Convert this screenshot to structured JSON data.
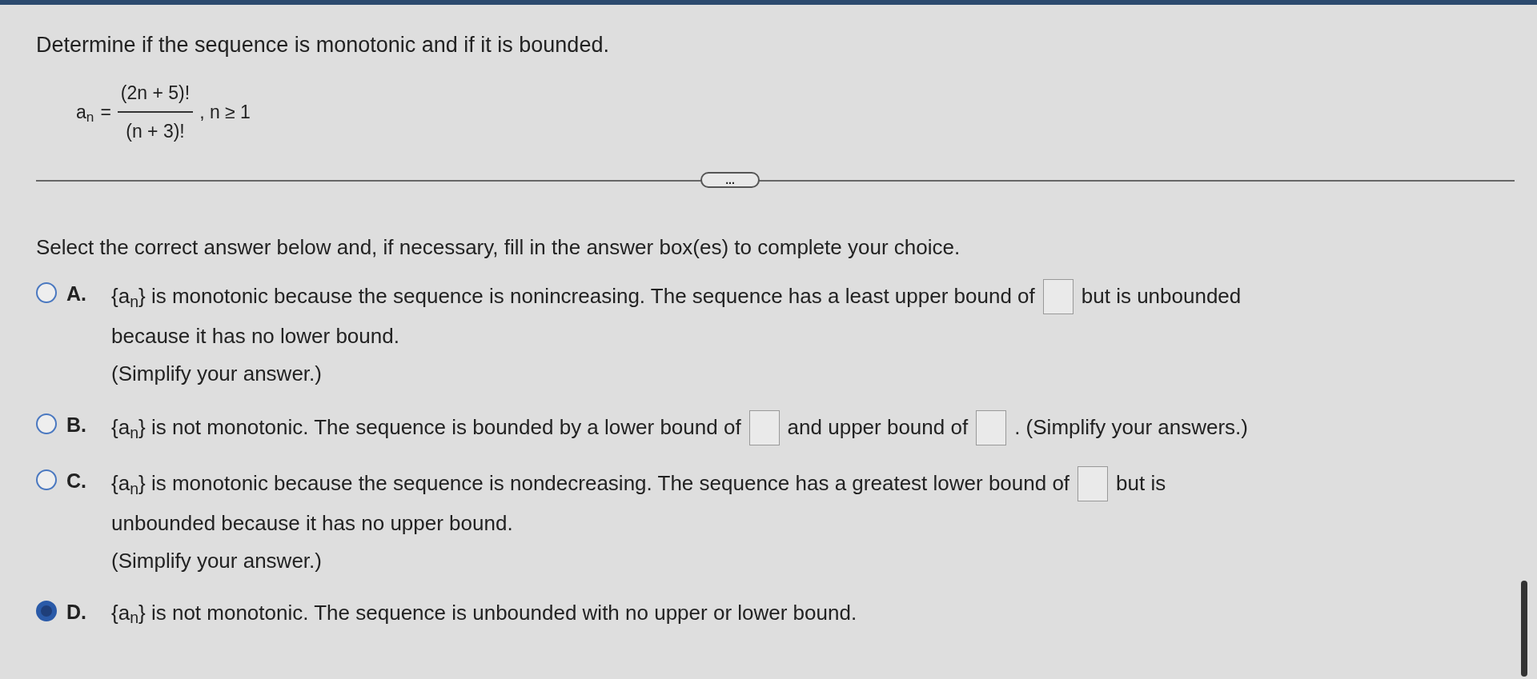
{
  "question": "Determine if the sequence is monotonic and if it is bounded.",
  "formula": {
    "lhs": "a$_{n}$",
    "equals": "=",
    "numerator": "(2n + 5)!",
    "denominator": "(n + 3)!",
    "condition": ", n ≥ 1"
  },
  "more_button": "...",
  "prompt": "Select the correct answer below and, if necessary, fill in the answer box(es) to complete your choice.",
  "options": [
    {
      "letter": "A.",
      "selected": false,
      "lines": [
        [
          {
            "kind": "text",
            "text": "{a$_{n}$} is monotonic because the sequence is nonincreasing. The sequence has a least upper bound of"
          },
          {
            "kind": "answer_box"
          },
          {
            "kind": "text",
            "text": "but is unbounded"
          }
        ],
        [
          {
            "kind": "text",
            "text": "because it has no lower bound."
          }
        ],
        [
          {
            "kind": "text",
            "text": "(Simplify your answer.)"
          }
        ]
      ]
    },
    {
      "letter": "B.",
      "selected": false,
      "lines": [
        [
          {
            "kind": "text",
            "text": "{a$_{n}$} is  not monotonic. The sequence is bounded by a lower bound of"
          },
          {
            "kind": "answer_box"
          },
          {
            "kind": "text",
            "text": "and upper bound of"
          },
          {
            "kind": "answer_box"
          },
          {
            "kind": "text",
            "text": ". (Simplify your answers.)"
          }
        ]
      ]
    },
    {
      "letter": "C.",
      "selected": false,
      "lines": [
        [
          {
            "kind": "text",
            "text": "{a$_{n}$} is monotonic because the sequence is nondecreasing. The sequence has a greatest lower bound of"
          },
          {
            "kind": "answer_box"
          },
          {
            "kind": "text",
            "text": "but is"
          }
        ],
        [
          {
            "kind": "text",
            "text": "unbounded because it has no upper bound."
          }
        ],
        [
          {
            "kind": "text",
            "text": "(Simplify your answer.)"
          }
        ]
      ]
    },
    {
      "letter": "D.",
      "selected": true,
      "lines": [
        [
          {
            "kind": "text",
            "text": "{a$_{n}$} is not monotonic. The sequence is unbounded with no upper or lower bound."
          }
        ]
      ]
    }
  ]
}
